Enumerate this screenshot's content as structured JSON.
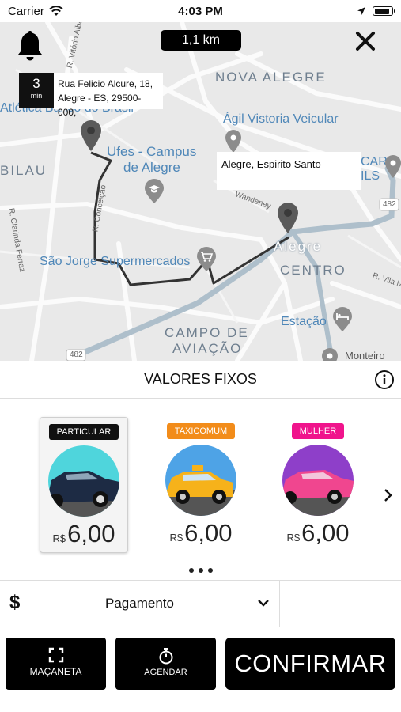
{
  "status_bar": {
    "carrier": "Carrier",
    "time": "4:03 PM"
  },
  "map": {
    "distance": "1,1 km",
    "eta": {
      "value": "3",
      "unit": "min"
    },
    "origin_address": {
      "line1": "Rua Felicio Alcure, 18,",
      "line2": "Alegre - ES, 29500-000,"
    },
    "destination_address": "Alegre, Espirito Santo",
    "labels": {
      "nova_alegre": "NOVA ALEGRE",
      "agil": "Ágil Vistoria Veicular",
      "ufes_1": "Ufes - Campus",
      "ufes_2": "de Alegre",
      "bilau": "BILAU",
      "atletica": "Atlética Banco do Brasil",
      "sao_jorge": "São Jorge Supermercados",
      "alegre": "Alegre",
      "centro": "CENTRO",
      "campo_1": "CAMPO DE",
      "campo_2": "AVIAÇÃO",
      "estacao": "Estação",
      "monteiro": "Monteiro",
      "road_482_a": "482",
      "road_482_b": "482",
      "r_conceicao": "R. Conceição",
      "r_clarinda": "R. Clarinda Ferraz",
      "r_vila": "R. Vila Ma",
      "wanderley": "Wanderley",
      "vitorio": "R. Vitório Albar",
      "car_ils": "CAR\nILS"
    }
  },
  "section_title": "VALORES FIXOS",
  "cars": [
    {
      "badge": "PARTICULAR",
      "badge_color": "#111111",
      "currency": "R$",
      "price": "6,00",
      "selected": true
    },
    {
      "badge": "TAXICOMUM",
      "badge_color": "#f28c1a",
      "currency": "R$",
      "price": "6,00",
      "selected": false
    },
    {
      "badge": "MULHER",
      "badge_color": "#f0148c",
      "currency": "R$",
      "price": "6,00",
      "selected": false
    }
  ],
  "payment": {
    "icon": "$",
    "label": "Pagamento"
  },
  "actions": {
    "macaneta": "MAÇANETA",
    "agendar": "AGENDAR",
    "confirm": "CONFIRMAR"
  }
}
